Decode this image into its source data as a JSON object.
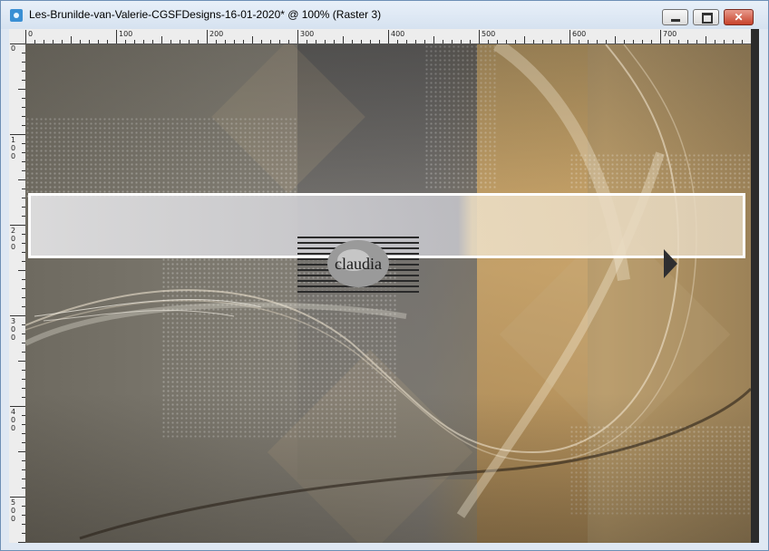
{
  "window": {
    "title": "Les-Brunilde-van-Valerie-CGSFDesigns-16-01-2020* @ 100% (Raster 3)",
    "buttons": [
      "minimize",
      "maximize",
      "close"
    ]
  },
  "ruler": {
    "top_labels": [
      "0",
      "100",
      "200",
      "300",
      "400",
      "500",
      "600",
      "700"
    ],
    "left_labels": [
      "0",
      "100",
      "200",
      "300",
      "400",
      "500"
    ]
  },
  "canvas": {
    "logo_text": "claudia",
    "colors": {
      "gold": "#c8a46a",
      "taupe": "#7e7a70",
      "banner_border": "#ffffff"
    }
  }
}
